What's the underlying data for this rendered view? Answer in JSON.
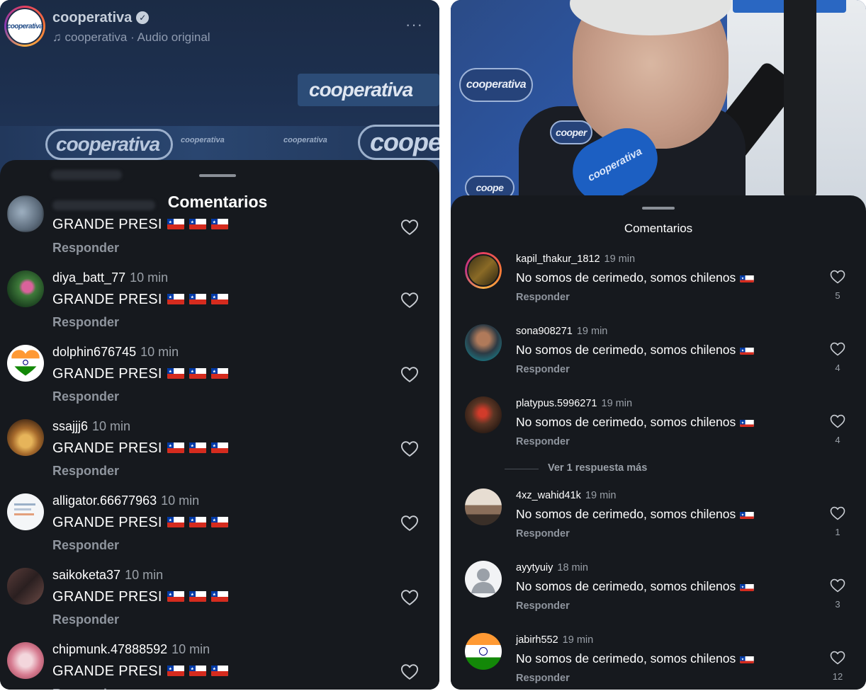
{
  "left": {
    "header": {
      "account_name": "cooperativa",
      "audio_line": "cooperativa · Audio original",
      "avatar_text": "cooperativa",
      "more": "···"
    },
    "video_logos": [
      "cooperativa",
      "cooperativa",
      "coope"
    ],
    "sheet_title": "Comentarios",
    "comments": [
      {
        "user": "",
        "time": "",
        "text": "GRANDE PRESI",
        "flags": 3,
        "reply": "Responder",
        "avatar": "blurred"
      },
      {
        "user": "diya_batt_77",
        "time": "10 min",
        "text": "GRANDE PRESI",
        "flags": 3,
        "reply": "Responder",
        "avatar": "flower"
      },
      {
        "user": "dolphin676745",
        "time": "10 min",
        "text": "GRANDE PRESI",
        "flags": 3,
        "reply": "Responder",
        "avatar": "india-heart"
      },
      {
        "user": "ssajjj6",
        "time": "10 min",
        "text": "GRANDE PRESI",
        "flags": 3,
        "reply": "Responder",
        "avatar": "food"
      },
      {
        "user": "alligator.66677963",
        "time": "10 min",
        "text": "GRANDE PRESI",
        "flags": 3,
        "reply": "Responder",
        "avatar": "document"
      },
      {
        "user": "saikoketa37",
        "time": "10 min",
        "text": "GRANDE PRESI",
        "flags": 3,
        "reply": "Responder",
        "avatar": "dark-photo"
      },
      {
        "user": "chipmunk.47888592",
        "time": "10 min",
        "text": "GRANDE PRESI",
        "flags": 3,
        "reply": "Responder",
        "avatar": "pink-photo"
      }
    ]
  },
  "right": {
    "video_logos": [
      "cooperativa",
      "cooper",
      "cooperativa",
      "coope"
    ],
    "sheet_title": "Comentarios",
    "more_replies": "Ver 1 respuesta más",
    "comments": [
      {
        "user": "kapil_thakur_1812",
        "time": "19 min",
        "text": "No somos de cerimedo, somos chilenos",
        "reply": "Responder",
        "likes": "5",
        "avatar": "story-ring"
      },
      {
        "user": "sona908271",
        "time": "19 min",
        "text": "No somos de cerimedo, somos chilenos",
        "reply": "Responder",
        "likes": "4",
        "avatar": "person-photo"
      },
      {
        "user": "platypus.5996271",
        "time": "19 min",
        "text": "No somos de cerimedo, somos chilenos",
        "reply": "Responder",
        "likes": "4",
        "avatar": "red-photo"
      },
      {
        "user": "4xz_wahid41k",
        "time": "19 min",
        "text": "No somos de cerimedo, somos chilenos",
        "reply": "Responder",
        "likes": "1",
        "avatar": "street-photo"
      },
      {
        "user": "ayytyuiy",
        "time": "18 min",
        "text": "No somos de cerimedo, somos chilenos",
        "reply": "Responder",
        "likes": "3",
        "avatar": "default"
      },
      {
        "user": "jabirh552",
        "time": "19 min",
        "text": "No somos de cerimedo, somos chilenos",
        "reply": "Responder",
        "likes": "12",
        "avatar": "india-flag"
      }
    ]
  },
  "colors": {
    "sheet_bg": "#16191e",
    "secondary_text": "#9aa0a8",
    "chile_red": "#d52b1e",
    "chile_blue": "#0039a6"
  }
}
